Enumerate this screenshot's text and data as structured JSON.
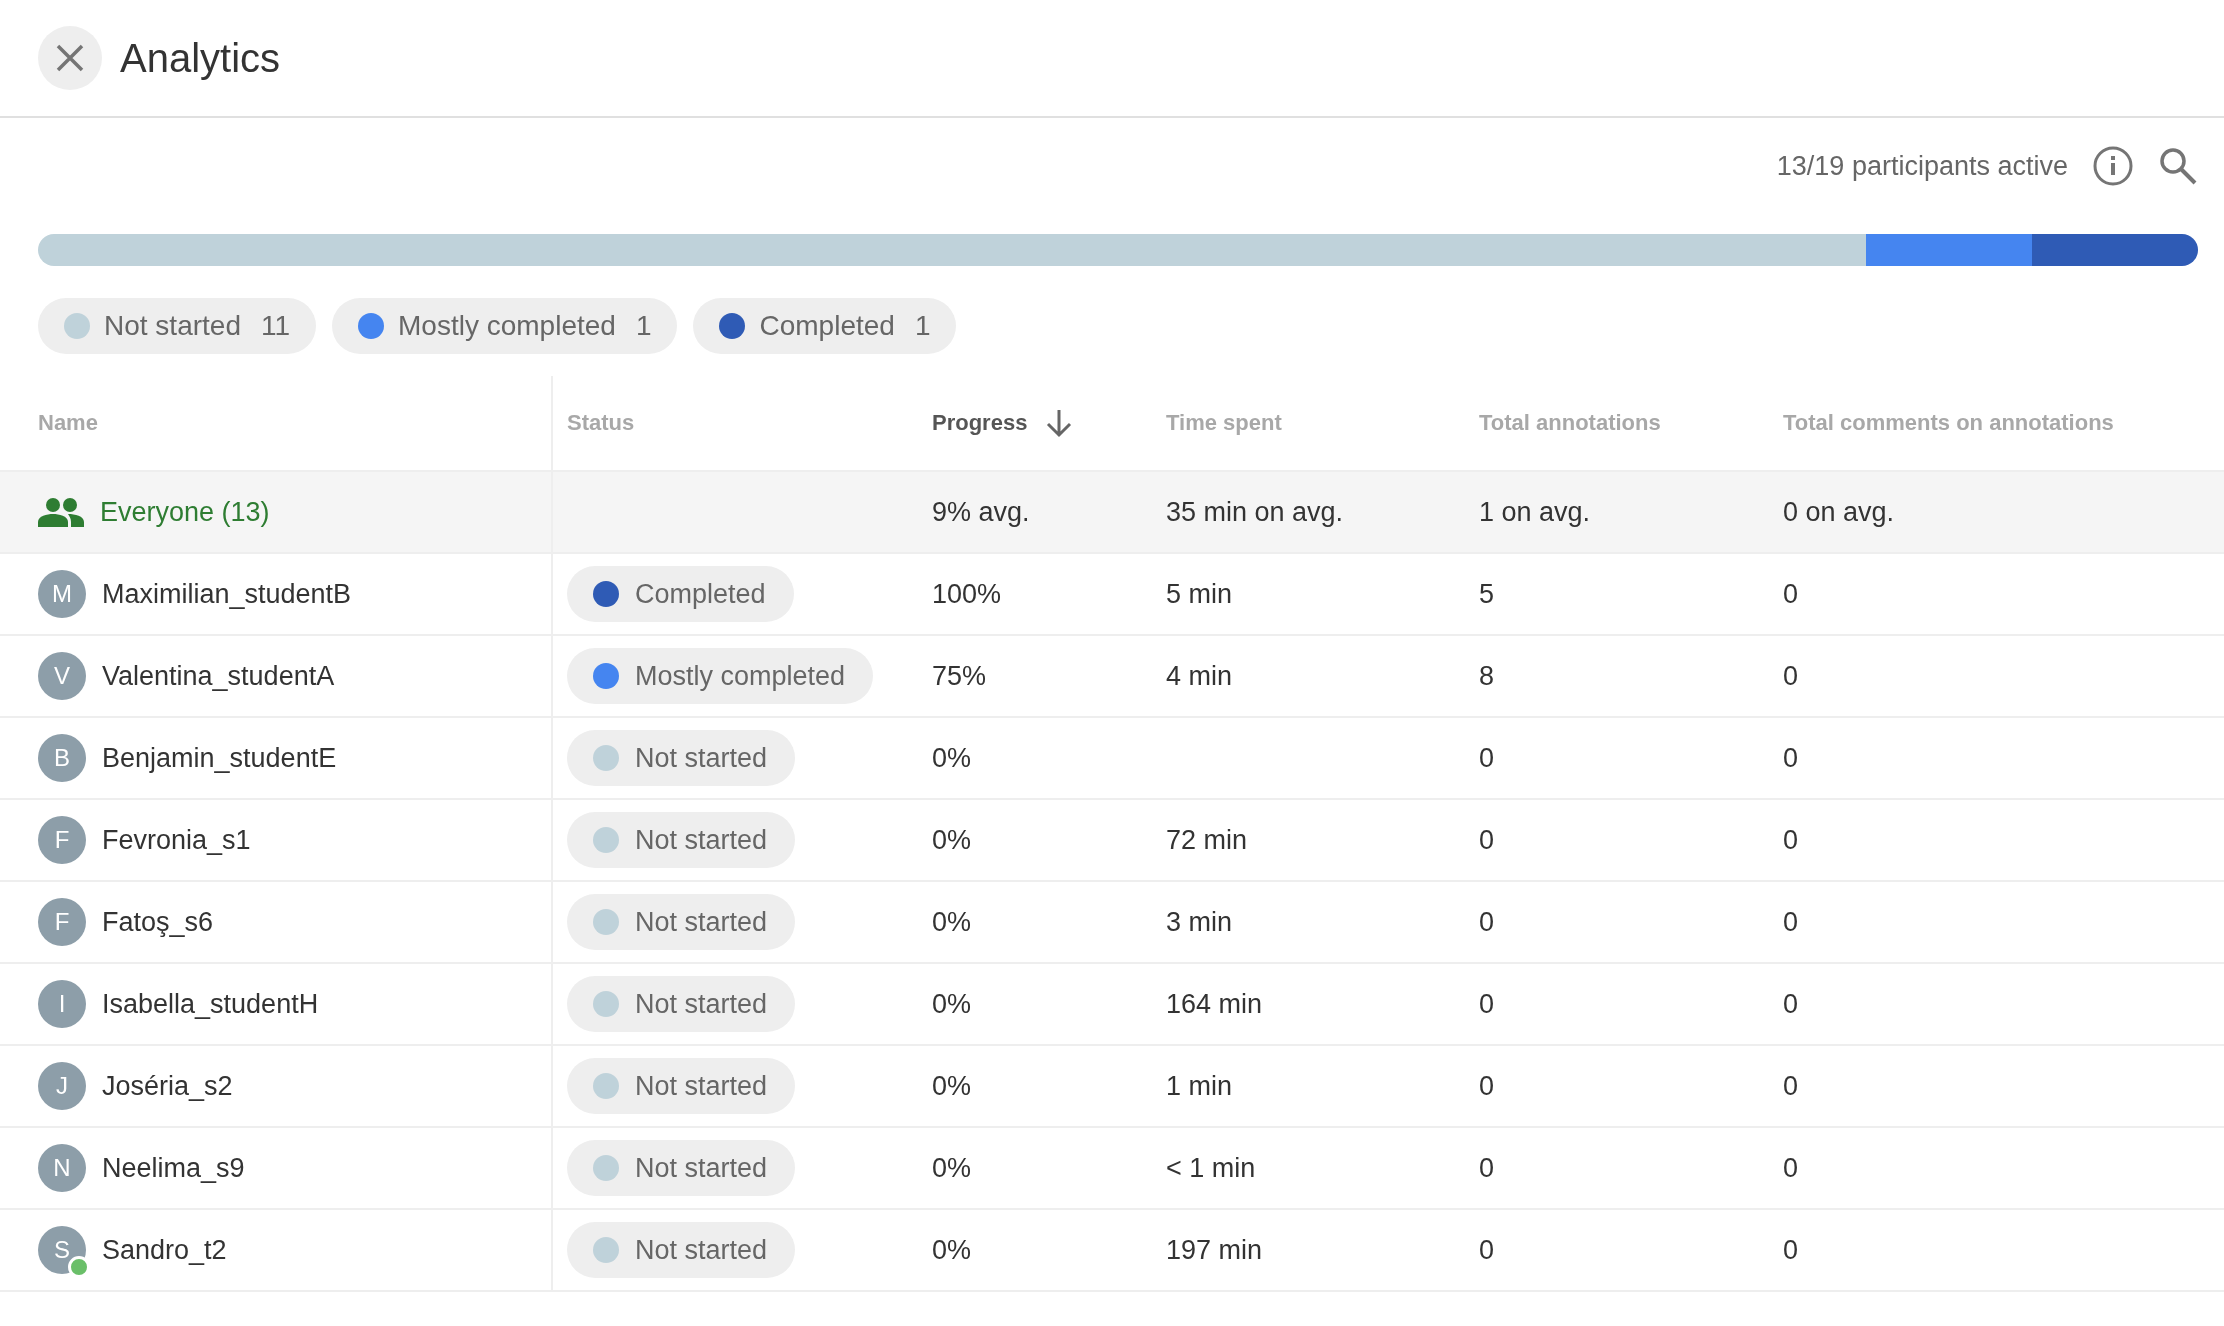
{
  "header": {
    "title": "Analytics"
  },
  "summary": {
    "participants_active": "13/19 participants active"
  },
  "legend": [
    {
      "label": "Not started",
      "count": "11",
      "color": "#bfd2da"
    },
    {
      "label": "Mostly completed",
      "count": "1",
      "color": "#4585f0"
    },
    {
      "label": "Completed",
      "count": "1",
      "color": "#2f5bb5"
    }
  ],
  "table": {
    "columns": [
      {
        "label": "Name",
        "sorted": false
      },
      {
        "label": "Status",
        "sorted": false
      },
      {
        "label": "Progress",
        "sorted": true
      },
      {
        "label": "Time spent",
        "sorted": false
      },
      {
        "label": "Total annotations",
        "sorted": false
      },
      {
        "label": "Total comments on annotations",
        "sorted": false
      }
    ],
    "summary_row": {
      "name": "Everyone (13)",
      "progress": "9% avg.",
      "time_spent": "35 min on avg.",
      "annotations": "1 on avg.",
      "comments": "0 on avg."
    },
    "rows": [
      {
        "initial": "M",
        "name": "Maximilian_studentB",
        "online": false,
        "status": {
          "label": "Completed",
          "color": "#2f5bb5"
        },
        "progress": "100%",
        "time_spent": "5 min",
        "annotations": "5",
        "comments": "0"
      },
      {
        "initial": "V",
        "name": "Valentina_studentA",
        "online": false,
        "status": {
          "label": "Mostly completed",
          "color": "#4585f0"
        },
        "progress": "75%",
        "time_spent": "4 min",
        "annotations": "8",
        "comments": "0"
      },
      {
        "initial": "B",
        "name": "Benjamin_studentE",
        "online": false,
        "status": {
          "label": "Not started",
          "color": "#bfd2da"
        },
        "progress": "0%",
        "annotations": "0",
        "comments": "0"
      },
      {
        "initial": "F",
        "name": "Fevronia_s1",
        "online": false,
        "status": {
          "label": "Not started",
          "color": "#bfd2da"
        },
        "progress": "0%",
        "time_spent": "72 min",
        "annotations": "0",
        "comments": "0"
      },
      {
        "initial": "F",
        "name": "Fatoş_s6",
        "online": false,
        "status": {
          "label": "Not started",
          "color": "#bfd2da"
        },
        "progress": "0%",
        "time_spent": "3 min",
        "annotations": "0",
        "comments": "0"
      },
      {
        "initial": "I",
        "name": "Isabella_studentH",
        "online": false,
        "status": {
          "label": "Not started",
          "color": "#bfd2da"
        },
        "progress": "0%",
        "time_spent": "164 min",
        "annotations": "0",
        "comments": "0"
      },
      {
        "initial": "J",
        "name": "Joséria_s2",
        "online": false,
        "status": {
          "label": "Not started",
          "color": "#bfd2da"
        },
        "progress": "0%",
        "time_spent": "1 min",
        "annotations": "0",
        "comments": "0"
      },
      {
        "initial": "N",
        "name": "Neelima_s9",
        "online": false,
        "status": {
          "label": "Not started",
          "color": "#bfd2da"
        },
        "progress": "0%",
        "time_spent": "< 1 min",
        "annotations": "0",
        "comments": "0"
      },
      {
        "initial": "S",
        "name": "Sandro_t2",
        "online": true,
        "status": {
          "label": "Not started",
          "color": "#bfd2da"
        },
        "progress": "0%",
        "time_spent": "197 min",
        "annotations": "0",
        "comments": "0"
      }
    ]
  }
}
